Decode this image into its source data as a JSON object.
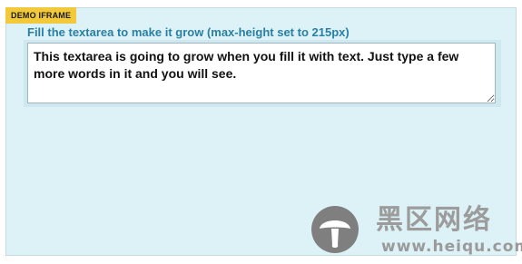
{
  "badge": {
    "label": "DEMO IFRAME"
  },
  "form": {
    "label": "Fill the textarea to make it grow (max-height set to 215px)",
    "textarea_value": "This textarea is going to grow when you fill it with text. Just type a few more words in it and you will see."
  },
  "watermark": {
    "name": "黑区网络",
    "url": "www.heiqu.com",
    "icon": "mushroom-icon"
  },
  "colors": {
    "frame_bg": "#ddf2f7",
    "label": "#2a7fa3",
    "badge_bg": "#f2c93a",
    "field_wrap_bg": "#cfe7ee"
  }
}
